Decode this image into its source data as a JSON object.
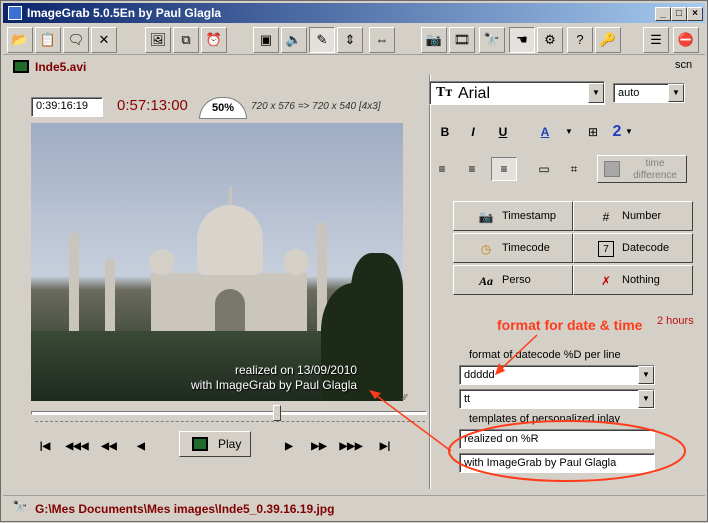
{
  "window": {
    "title": "ImageGrab 5.0.5En by Paul Glagla"
  },
  "title_buttons": [
    "_",
    "□",
    "×"
  ],
  "toolbar": {
    "tools": [
      {
        "icon": "folder-open-icon",
        "glyph": "📂"
      },
      {
        "icon": "paste-icon",
        "glyph": "📋"
      },
      {
        "icon": "comment-icon",
        "glyph": "🗨"
      },
      {
        "icon": "cross-icon",
        "glyph": "✕"
      },
      {
        "icon": "image-export-icon",
        "glyph": "🖼"
      },
      {
        "icon": "copy-icon",
        "glyph": "⧉"
      },
      {
        "icon": "alarm-clock-icon",
        "glyph": "⏰"
      },
      {
        "icon": "screen-icon",
        "glyph": "▣"
      },
      {
        "icon": "speaker-icon",
        "glyph": "🔈"
      },
      {
        "icon": "pen-icon",
        "glyph": "✎"
      },
      {
        "icon": "vertical-resize-icon",
        "glyph": "⇕"
      },
      {
        "icon": "horizontal-resize-icon",
        "glyph": "⇔"
      },
      {
        "icon": "camera-icon",
        "glyph": "📷"
      },
      {
        "icon": "film-icon",
        "glyph": "🎞"
      },
      {
        "icon": "binoculars-icon",
        "glyph": "🔭"
      },
      {
        "icon": "hand-icon",
        "glyph": "☚"
      },
      {
        "icon": "settings-icon",
        "glyph": "⚙"
      },
      {
        "icon": "help-icon",
        "glyph": "?"
      },
      {
        "icon": "key-icon",
        "glyph": "🔑"
      },
      {
        "icon": "list-icon",
        "glyph": "☰"
      },
      {
        "icon": "stop-icon",
        "glyph": "⛔"
      }
    ]
  },
  "file": {
    "name": "Inde5.avi",
    "mode": "scn"
  },
  "video": {
    "position": "0:39:16:19",
    "duration": "0:57:13:00",
    "zoom": "50%",
    "resolution": "720 x 576  =>  720 x 540 [4x3]",
    "overlay_line1": "realized on 13/09/2010",
    "overlay_line2": "with ImageGrab by Paul Glagla",
    "seek_position": 0.62
  },
  "controls": {
    "play_label": "Play",
    "nav_left": [
      "|◀",
      "◀◀◀",
      "◀◀",
      "◀"
    ],
    "nav_right": [
      "▶",
      "▶▶",
      "▶▶▶",
      "▶|"
    ]
  },
  "font": {
    "name": "Arial",
    "size": "auto",
    "size_number": "2"
  },
  "format_buttons": [
    "B",
    "I",
    "U",
    "A"
  ],
  "timediff": "time difference",
  "stamp_buttons": [
    {
      "label": "Timestamp",
      "glyph": "📷"
    },
    {
      "label": "Number",
      "glyph": "#"
    },
    {
      "label": "Timecode",
      "glyph": "◷"
    },
    {
      "label": "Datecode",
      "glyph": "7"
    },
    {
      "label": "Perso",
      "glyph": "Aa"
    },
    {
      "label": "Nothing",
      "glyph": "✗"
    }
  ],
  "annotation": {
    "text": "format for date & time",
    "color": "#ff3b1a"
  },
  "hours_label": "2 hours",
  "datecode": {
    "label": "format of datecode %D per line",
    "line1": "ddddd",
    "line2": "tt"
  },
  "templates": {
    "label": "templates of personalized inlay",
    "line1": "realized on %R",
    "line2": "with ImageGrab by Paul Glagla"
  },
  "status": {
    "path": "G:\\Mes Documents\\Mes images\\Inde5_0.39.16.19.jpg"
  }
}
